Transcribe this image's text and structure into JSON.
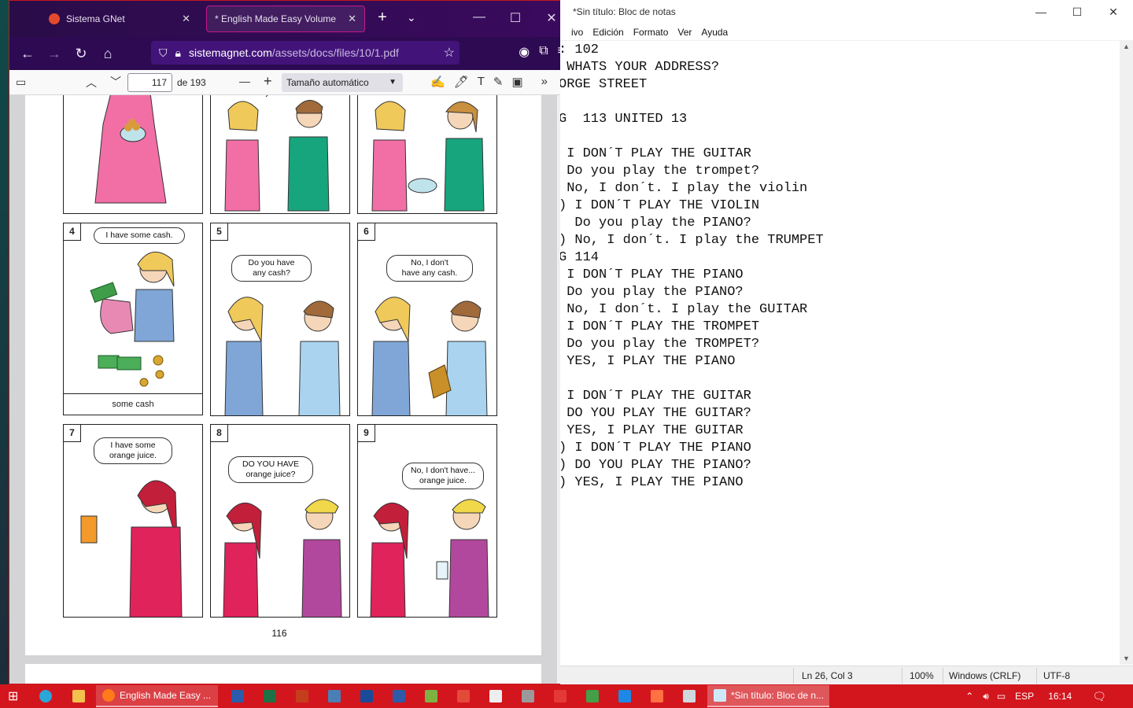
{
  "firefox": {
    "tabs": [
      {
        "label": "Sistema GNet",
        "active": false
      },
      {
        "label": "* English Made Easy Volume",
        "active": true
      }
    ],
    "new_tab": "+",
    "url_host": "sistemagnet.com",
    "url_path": "/assets/docs/files/10/1.pdf",
    "pdf_toolbar": {
      "page_value": "117",
      "page_of": "de 193",
      "zoom_label": "Tamaño automático"
    },
    "page_footer_number": "116",
    "comic": {
      "panel4": {
        "num": "4",
        "bubble": "I have some cash.",
        "caption": "some cash"
      },
      "panel5": {
        "num": "5",
        "bubble_line1": "Do you have",
        "bubble_line2": "any cash?"
      },
      "panel6": {
        "num": "6",
        "bubble_line1": "No, I don't",
        "bubble_line2": "have any cash."
      },
      "panel7": {
        "num": "7",
        "bubble_line1": "I have some",
        "bubble_line2": "orange juice."
      },
      "panel8": {
        "num": "8",
        "bubble_line1": "DO YOU HAVE",
        "bubble_line2": "orange juice?"
      },
      "panel9": {
        "num": "9",
        "bubble_line1": "No, I don't have...",
        "bubble_line2": "orange juice."
      }
    }
  },
  "notepad": {
    "title": "*Sin título: Bloc de notas",
    "menu": [
      "ivo",
      "Edición",
      "Formato",
      "Ver",
      "Ayuda"
    ],
    "lines": [
      ": 102",
      " WHATS YOUR ADDRESS?",
      "ORGE STREET",
      "",
      "G  113 UNITED 13",
      "",
      " I DON´T PLAY THE GUITAR",
      " Do you play the trompet?",
      " No, I don´t. I play the violin",
      ") I DON´T PLAY THE VIOLIN",
      "  Do you play the PIANO?",
      ") No, I don´t. I play the TRUMPET",
      "G 114",
      " I DON´T PLAY THE PIANO",
      " Do you play the PIANO?",
      " No, I don´t. I play the GUITAR",
      " I DON´T PLAY THE TROMPET",
      " Do you play the TROMPET?",
      " YES, I PLAY THE PIANO",
      "",
      " I DON´T PLAY THE GUITAR",
      " DO YOU PLAY THE GUITAR?",
      " YES, I PLAY THE GUITAR",
      ") I DON´T PLAY THE PIANO",
      ") DO YOU PLAY THE PIANO?",
      ") YES, I PLAY THE PIANO"
    ],
    "status": {
      "position": "Ln 26, Col 3",
      "zoom": "100%",
      "line_ending": "Windows (CRLF)",
      "encoding": "UTF-8"
    }
  },
  "taskbar": {
    "task_firefox": "English Made Easy ...",
    "task_notepad": "*Sin título: Bloc de n...",
    "language": "ESP",
    "time": "16:14"
  }
}
